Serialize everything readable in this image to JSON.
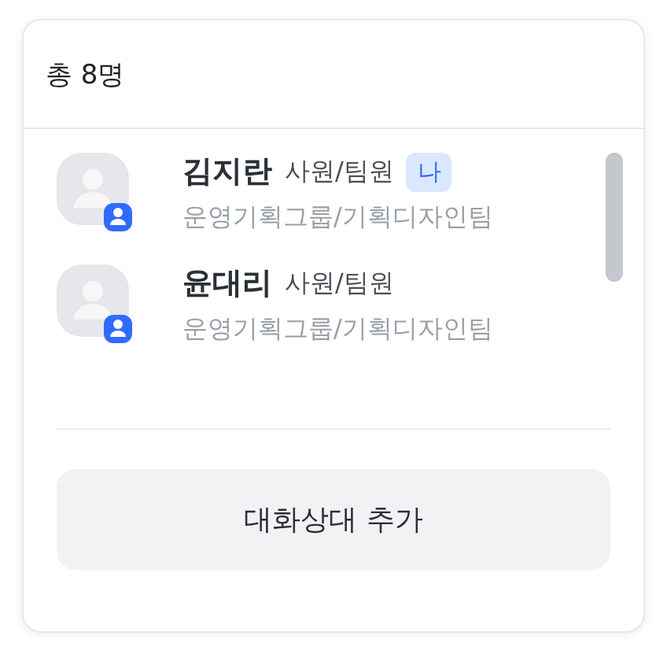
{
  "header": {
    "title": "총 8명"
  },
  "members": [
    {
      "name": "김지란",
      "position": "사원/팀원",
      "tag": "나",
      "department": "운영기획그룹/기획디자인팀"
    },
    {
      "name": "윤대리",
      "position": "사원/팀원",
      "department": "운영기획그룹/기획디자인팀"
    }
  ],
  "add_button": "대화상대 추가"
}
